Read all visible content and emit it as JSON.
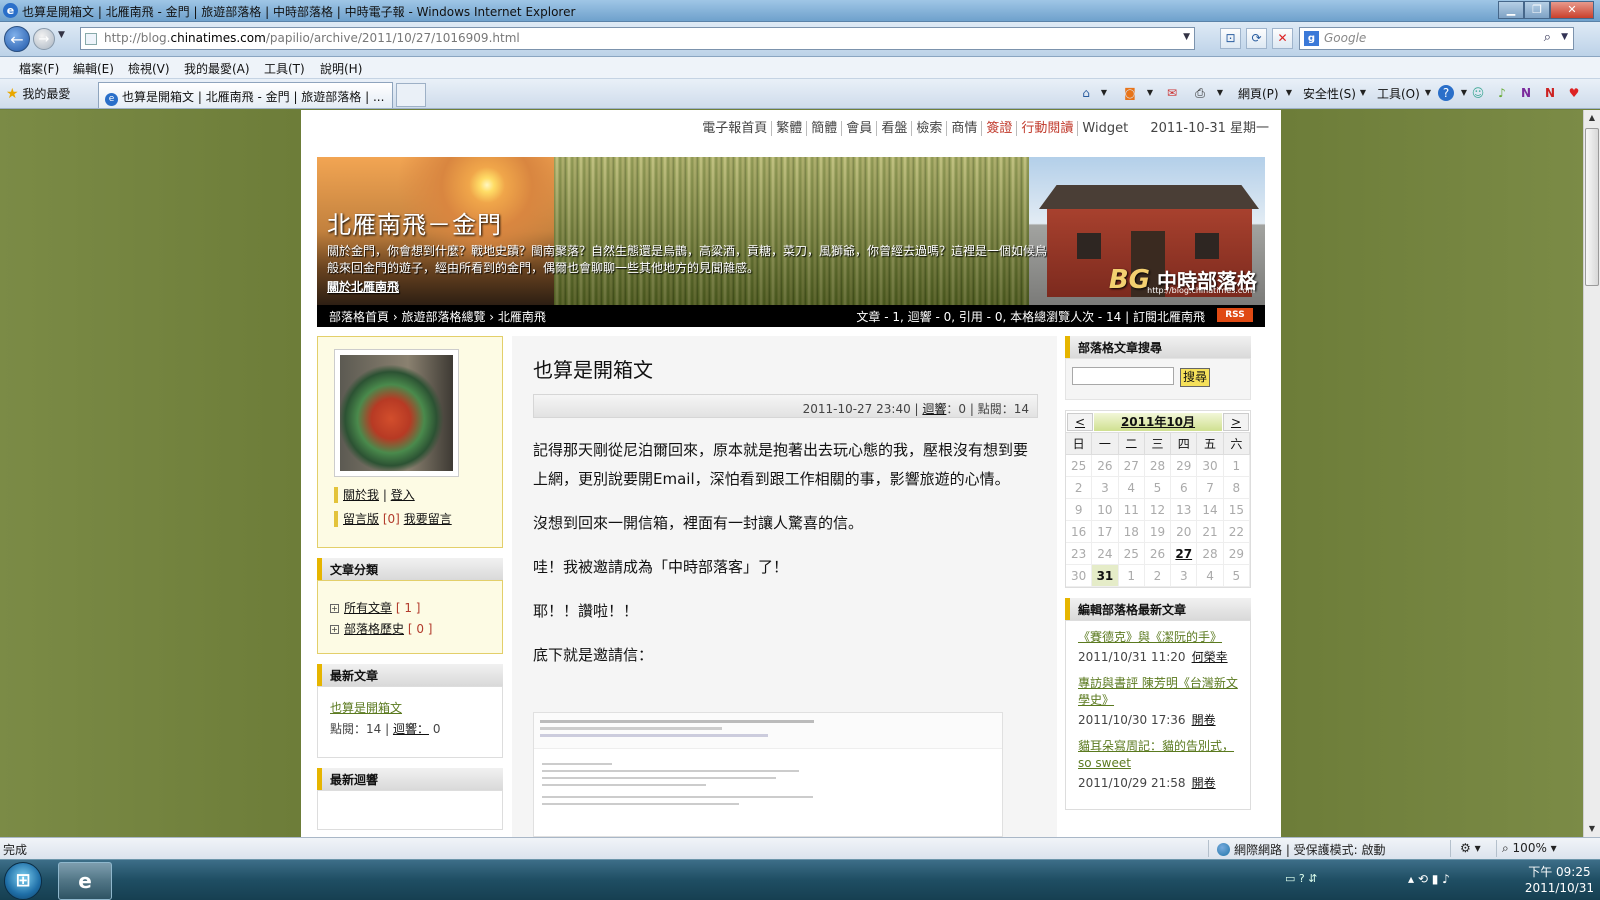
{
  "window": {
    "title": "也算是開箱文 | 北雁南飛 - 金門 | 旅遊部落格 | 中時部落格 | 中時電子報 - Windows Internet Explorer",
    "min_glyph": "▁",
    "max_glyph": "❐",
    "close_glyph": "✕"
  },
  "browser": {
    "url_prefix": "http://blog.",
    "url_domain": "chinatimes.com",
    "url_suffix": "/papilio/archive/2011/10/27/1016909.html",
    "search_placeholder": "Google",
    "menu": [
      "檔案(F)",
      "編輯(E)",
      "檢視(V)",
      "我的最愛(A)",
      "工具(T)",
      "說明(H)"
    ],
    "favorites_label": "我的最愛",
    "tab_title": "也算是開箱文 | 北雁南飛 - 金門 | 旅遊部落格 | ...",
    "toolbar": {
      "page": "網頁(P)",
      "safety": "安全性(S)",
      "tools": "工具(O)"
    }
  },
  "site": {
    "topnav": [
      "電子報首頁",
      "繁體",
      "簡體",
      "會員",
      "看盤",
      "檢索",
      "商情",
      "簽證",
      "行動閱讀",
      "Widget"
    ],
    "topnav_highlight_color": "#c0392b",
    "date": "2011-10-31 星期一"
  },
  "banner": {
    "title": "北雁南飛－金門",
    "desc": "關於金門，你會想到什麼？戰地史蹟？閩南聚落？自然生態還是烏鵲，高粱酒，貢糖，菜刀，風獅爺，你曾經去過嗎？這裡是一個如候鳥般來回金門的遊子，經由所看到的金門，偶爾也會聊聊一些其他地方的見聞雜感。",
    "about_link": "關於北雁南飛",
    "logo": "中時部落格",
    "logo_url": "http://blog.chinatimes.com",
    "logo_mark": "BG"
  },
  "breadcrumb": {
    "home": "部落格首頁",
    "cat": "旅遊部落格總覽",
    "current": "北雁南飛",
    "stats": "文章 - 1, 迴響 - 0, 引用 - 0, 本格總瀏覽人次 - 14 | 訂閱北雁南飛",
    "rss": "RSS"
  },
  "left": {
    "about": "關於我",
    "login": "登入",
    "guestbook": "留言版",
    "guestbook_count": "0",
    "leave_msg": "我要留言",
    "cat_title": "文章分類",
    "categories": [
      {
        "name": "所有文章",
        "count": "1"
      },
      {
        "name": "部落格歷史",
        "count": "0"
      }
    ],
    "recent_title": "最新文章",
    "recent_post": "也算是開箱文",
    "recent_views_label": "點閱：",
    "recent_views": "14",
    "recent_reply_label": "迴響：",
    "recent_reply": "0",
    "responses_title": "最新迴響"
  },
  "post": {
    "title": "也算是開箱文",
    "datetime": "2011-10-27 23:40",
    "reply_label": "迴響",
    "reply_count": "：0",
    "views": "點閱：14",
    "paragraphs": [
      "記得那天剛從尼泊爾回來，原本就是抱著出去玩心態的我，壓根沒有想到要上網，更別說要開Email，深怕看到跟工作相關的事，影響旅遊的心情。",
      "沒想到回來一開信箱，裡面有一封讓人驚喜的信。",
      "哇！我被邀請成為「中時部落客」了！",
      "耶！！讚啦！！",
      "底下就是邀請信："
    ]
  },
  "right": {
    "search_title": "部落格文章搜尋",
    "search_button": "搜尋",
    "cal_prev": "<",
    "cal_next": ">",
    "cal_month": "2011年10月",
    "weekdays": [
      "日",
      "一",
      "二",
      "三",
      "四",
      "五",
      "六"
    ],
    "days": [
      "25",
      "26",
      "27",
      "28",
      "29",
      "30",
      "1",
      "2",
      "3",
      "4",
      "5",
      "6",
      "7",
      "8",
      "9",
      "10",
      "11",
      "12",
      "13",
      "14",
      "15",
      "16",
      "17",
      "18",
      "19",
      "20",
      "21",
      "22",
      "23",
      "24",
      "25",
      "26",
      "27",
      "28",
      "29",
      "30",
      "31",
      "1",
      "2",
      "3",
      "4",
      "5"
    ],
    "news_title": "編輯部落格最新文章",
    "news": [
      {
        "title": "《賽德克》與《潔阮的手》",
        "date": "2011/10/31 11:20",
        "author": "何榮幸"
      },
      {
        "title": "專訪與書評 陳芳明《台灣新文學史》",
        "date": "2011/10/30 17:36",
        "author": "開卷"
      },
      {
        "title": "貓耳朵寫周記：貓的告別式，so sweet",
        "date": "2011/10/29 21:58",
        "author": "開卷"
      }
    ]
  },
  "status": {
    "done": "完成",
    "zone": "網際網路 | 受保護模式: 啟動",
    "zoom": "100%"
  },
  "taskbar": {
    "time": "下午 09:25",
    "date": "2011/10/31"
  }
}
